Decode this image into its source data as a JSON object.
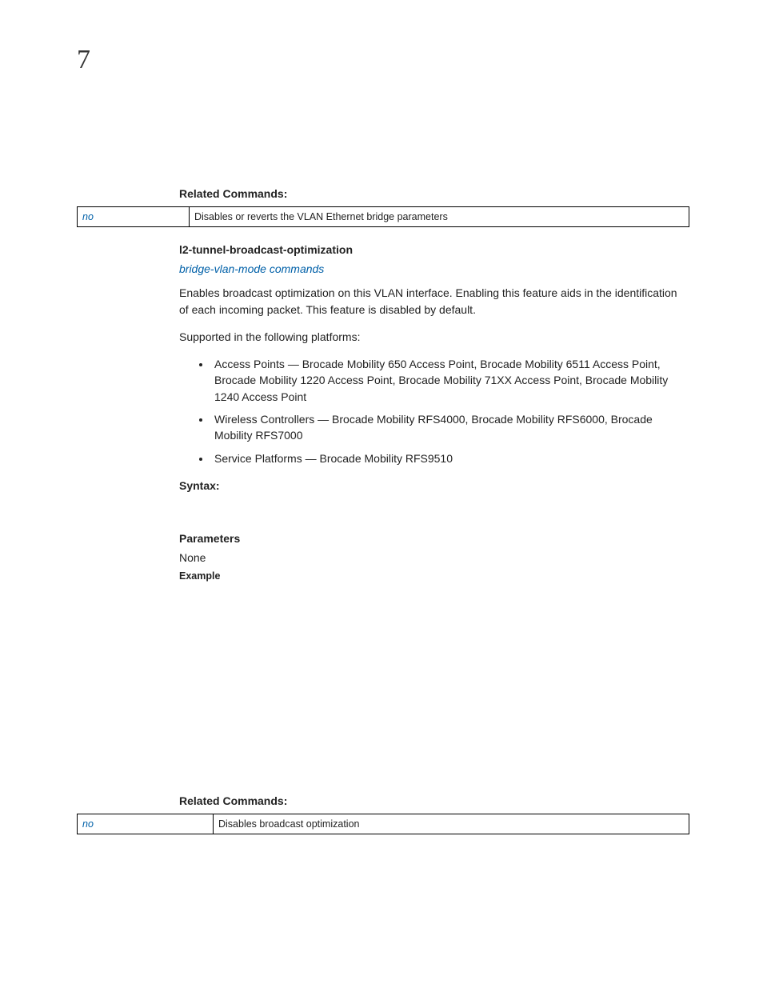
{
  "chapterNumber": "7",
  "related1": {
    "heading": "Related Commands:",
    "row": {
      "cmd": "no",
      "desc": "Disables or reverts the VLAN Ethernet bridge parameters"
    }
  },
  "topic": {
    "title": "l2-tunnel-broadcast-optimization",
    "parentLink": "bridge-vlan-mode commands",
    "desc": "Enables broadcast optimization on this VLAN interface. Enabling this feature aids in the identification of each incoming packet. This feature is disabled by default.",
    "supportedIntro": "Supported in the following platforms:",
    "bullets": [
      "Access Points — Brocade Mobility 650 Access Point, Brocade Mobility 6511 Access Point, Brocade Mobility 1220 Access Point, Brocade Mobility 71XX Access Point, Brocade Mobility 1240 Access Point",
      "Wireless Controllers — Brocade Mobility RFS4000, Brocade Mobility RFS6000, Brocade Mobility RFS7000",
      "Service Platforms — Brocade Mobility RFS9510"
    ],
    "syntaxHeading": "Syntax:",
    "paramsHeading": "Parameters",
    "paramsNone": "None",
    "exampleHeading": "Example"
  },
  "related2": {
    "heading": "Related Commands:",
    "row": {
      "cmd": "no",
      "desc": "Disables broadcast optimization"
    }
  }
}
